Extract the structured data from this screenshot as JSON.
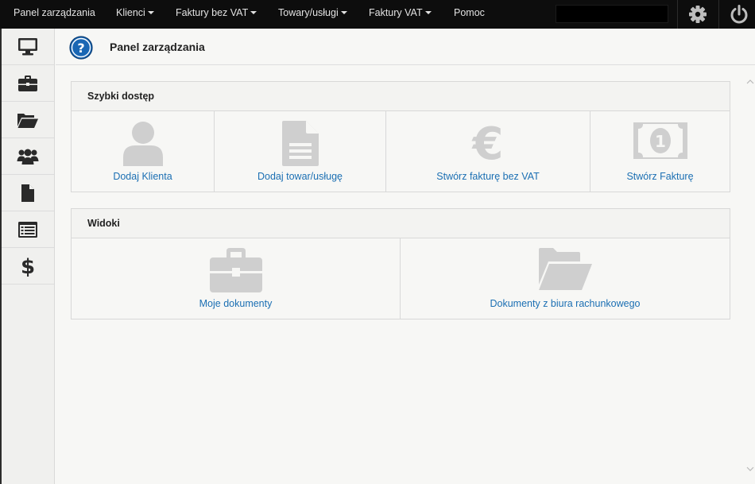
{
  "topnav": {
    "items": [
      {
        "label": "Panel zarządzania",
        "dropdown": false
      },
      {
        "label": "Klienci",
        "dropdown": true
      },
      {
        "label": "Faktury bez VAT",
        "dropdown": true
      },
      {
        "label": "Towary/usługi",
        "dropdown": true
      },
      {
        "label": "Faktury VAT",
        "dropdown": true
      },
      {
        "label": "Pomoc",
        "dropdown": false
      }
    ],
    "right_icons": [
      "gear-icon",
      "power-icon"
    ]
  },
  "sidebar": {
    "items": [
      {
        "icon": "monitor-icon"
      },
      {
        "icon": "briefcase-icon"
      },
      {
        "icon": "folder-open-icon"
      },
      {
        "icon": "users-icon"
      },
      {
        "icon": "document-icon"
      },
      {
        "icon": "list-icon"
      },
      {
        "icon": "dollar-icon"
      }
    ]
  },
  "header": {
    "title": "Panel zarządzania",
    "icon": "help-icon"
  },
  "quick_access": {
    "title": "Szybki dostęp",
    "tiles": [
      {
        "label": "Dodaj Klienta",
        "icon": "user-icon"
      },
      {
        "label": "Dodaj towar/usługę",
        "icon": "document-icon"
      },
      {
        "label": "Stwórz fakturę bez VAT",
        "icon": "euro-icon"
      },
      {
        "label": "Stwórz Fakturę",
        "icon": "banknote-icon"
      }
    ]
  },
  "views": {
    "title": "Widoki",
    "tiles": [
      {
        "label": "Moje dokumenty",
        "icon": "briefcase-icon"
      },
      {
        "label": "Dokumenty z biura rachunkowego",
        "icon": "folder-open-icon"
      }
    ]
  },
  "colors": {
    "topbar": "#0d0d0d",
    "link": "#1b6fb3",
    "tile_icon": "#cfcfcf",
    "sidebar_icon": "#2a2a2a",
    "help_blue": "#1a67b4"
  }
}
